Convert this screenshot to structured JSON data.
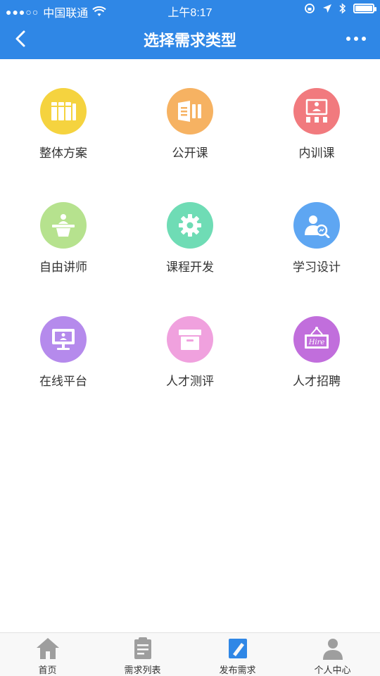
{
  "status_bar": {
    "carrier": "中国联通",
    "time": "上午8:17"
  },
  "header": {
    "title": "选择需求类型"
  },
  "categories": [
    {
      "label": "整体方案",
      "color": "#f5d33f",
      "icon": "books-icon"
    },
    {
      "label": "公开课",
      "color": "#f6b262",
      "icon": "open-course-icon"
    },
    {
      "label": "内训课",
      "color": "#f17a7e",
      "icon": "presentation-icon"
    },
    {
      "label": "自由讲师",
      "color": "#b6e28e",
      "icon": "lecturer-icon"
    },
    {
      "label": "课程开发",
      "color": "#6fdcb5",
      "icon": "gear-icon"
    },
    {
      "label": "学习设计",
      "color": "#5ea6f2",
      "icon": "user-search-icon"
    },
    {
      "label": "在线平台",
      "color": "#b58aec",
      "icon": "monitor-icon"
    },
    {
      "label": "人才测评",
      "color": "#f0a1de",
      "icon": "archive-box-icon"
    },
    {
      "label": "人才招聘",
      "color": "#c16edc",
      "icon": "hire-sign-icon"
    }
  ],
  "hire_sign_text": "Hire",
  "tabbar": [
    {
      "label": "首页",
      "icon": "home-icon"
    },
    {
      "label": "需求列表",
      "icon": "list-icon"
    },
    {
      "label": "发布需求",
      "icon": "publish-icon"
    },
    {
      "label": "个人中心",
      "icon": "profile-icon"
    }
  ]
}
